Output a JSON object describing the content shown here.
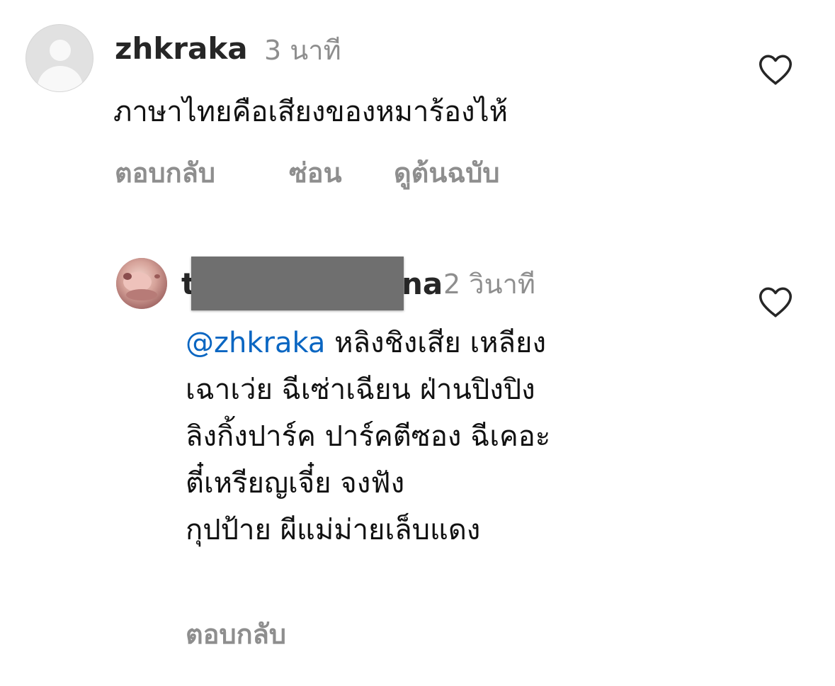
{
  "comments": [
    {
      "username": "zhkraka",
      "timestamp": "3 นาที",
      "text": "ภาษาไทยคือเสียงของหมาร้องไห้",
      "actions": {
        "reply": "ตอบกลับ",
        "hide": "ซ่อน",
        "see_original": "ดูต้นฉบับ"
      },
      "like_icon": "heart-outline-icon"
    }
  ],
  "reply": {
    "username_prefix": "t",
    "username_suffix": "na",
    "timestamp": "2 วินาที",
    "mention": "@zhkraka",
    "lines": [
      "หลิงชิงเสีย เหลียง",
      "เฉาเว่ย ฉีเซ่าเฉียน ฝ่านปิงปิง",
      "ลิงกิ้งปาร์ค ปาร์คตีซอง ฉีเคอะ",
      "ตี๋เหรียญเจี๋ย จงฟัง",
      "กุปป้าย ผีแม่ม่ายเล็บแดง"
    ],
    "actions": {
      "reply": "ตอบกลับ"
    },
    "like_icon": "heart-outline-icon"
  },
  "colors": {
    "primary_text": "#111111",
    "secondary_text": "#8e8e8e",
    "mention": "#0a66c2",
    "redaction": "#6f6f6f"
  }
}
